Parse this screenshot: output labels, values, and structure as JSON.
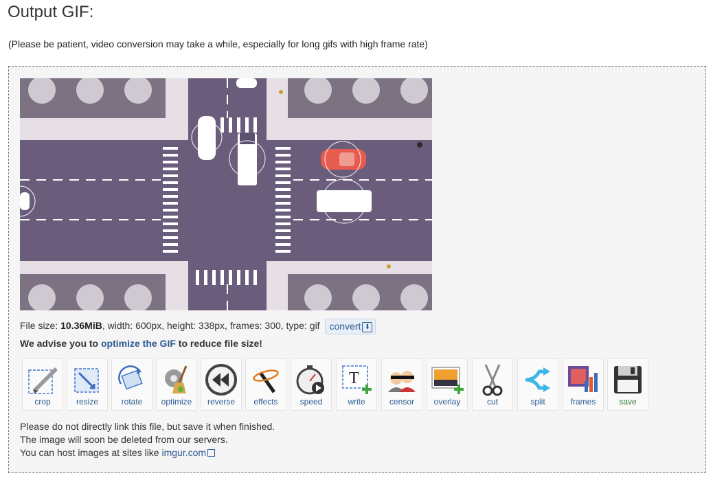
{
  "page": {
    "title": "Output GIF:",
    "notice": "(Please be patient, video conversion may take a while, especially for long gifs with high frame rate)"
  },
  "file_info": {
    "prefix": "File size: ",
    "size": "10.36MiB",
    "details": ", width: 600px, height: 338px, frames: 300, type: gif",
    "convert_label": "convert"
  },
  "advice": {
    "before": "We advise you to ",
    "link": "optimize the GIF",
    "after": " to reduce file size!"
  },
  "tools": {
    "crop": "crop",
    "resize": "resize",
    "rotate": "rotate",
    "optimize": "optimize",
    "reverse": "reverse",
    "effects": "effects",
    "speed": "speed",
    "write": "write",
    "censor": "censor",
    "overlay": "overlay",
    "cut": "cut",
    "split": "split",
    "frames": "frames",
    "save": "save"
  },
  "footer": {
    "line1": "Please do not directly link this file, but save it when finished.",
    "line2": "The image will soon be deleted from our servers.",
    "line3_prefix": "You can host images at sites like ",
    "link": "imgur.com"
  },
  "colors": {
    "link": "#2b5a92",
    "save": "#2e7a2e",
    "road": "#6a5c7b",
    "sidewalk": "#e6dfe6"
  }
}
